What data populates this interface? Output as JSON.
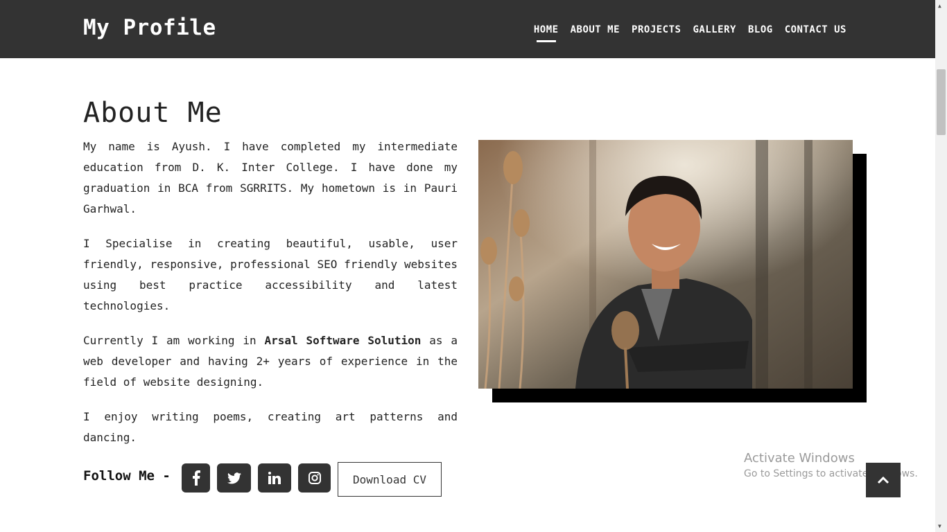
{
  "header": {
    "brand": "My Profile",
    "nav": [
      {
        "label": "HOME",
        "active": true
      },
      {
        "label": "ABOUT ME"
      },
      {
        "label": "PROJECTS"
      },
      {
        "label": "GALLERY"
      },
      {
        "label": "BLOG"
      },
      {
        "label": "CONTACT US"
      }
    ]
  },
  "about": {
    "title": "About Me",
    "p1": "My name is Ayush. I have completed my intermediate education from D. K. Inter College. I have done my graduation in BCA from SGRRITS. My hometown is in Pauri Garhwal.",
    "p2": "I Specialise in creating beautiful, usable, user friendly, responsive, professional SEO friendly websites using best practice accessibility and latest technologies.",
    "p3_before": "Currently I am working in ",
    "p3_company": "Arsal Software Solution",
    "p3_after": " as a web developer and having 2+ years of experience in the field of website designing.",
    "p4": "I enjoy writing poems, creating art patterns and dancing."
  },
  "follow": {
    "label": "Follow Me -",
    "icons": [
      "facebook-icon",
      "twitter-icon",
      "linkedin-icon",
      "instagram-icon"
    ],
    "cv_button": "Download CV"
  },
  "watermark": {
    "line1": "Activate Windows",
    "line2": "Go to Settings to activate Windows."
  },
  "colors": {
    "header_bg": "#333333",
    "button_bg": "#333333",
    "text": "#222222"
  }
}
